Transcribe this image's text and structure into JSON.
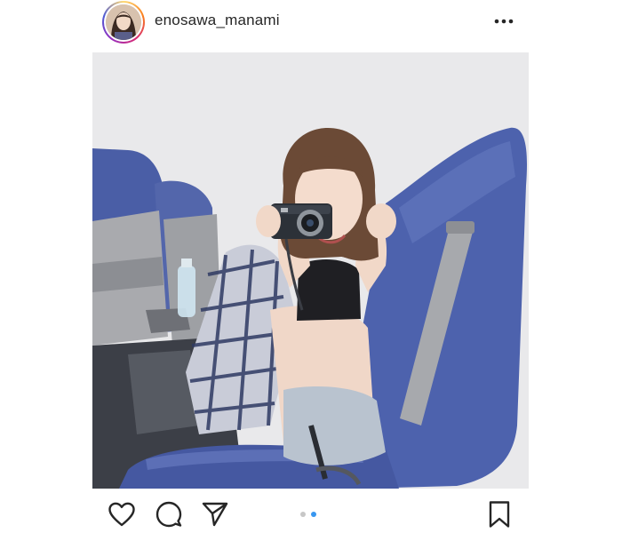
{
  "header": {
    "username": "enosawa_manami",
    "avatar_icon": "profile-photo",
    "more_icon": "more-options-icon",
    "ring_colors": [
      "#feda75",
      "#fa7e1e",
      "#d62976",
      "#962fbf",
      "#4f5bd5"
    ]
  },
  "post": {
    "image_icon": "post-photo",
    "background_color": "#e9e9eb",
    "seat_color": "#4b5fa6"
  },
  "actions": {
    "like_icon": "heart-icon",
    "comment_icon": "comment-icon",
    "share_icon": "send-icon",
    "save_icon": "bookmark-icon"
  },
  "carousel": {
    "total": 2,
    "current": 2,
    "active_color": "#3897f0",
    "inactive_color": "#c7c7c7"
  }
}
